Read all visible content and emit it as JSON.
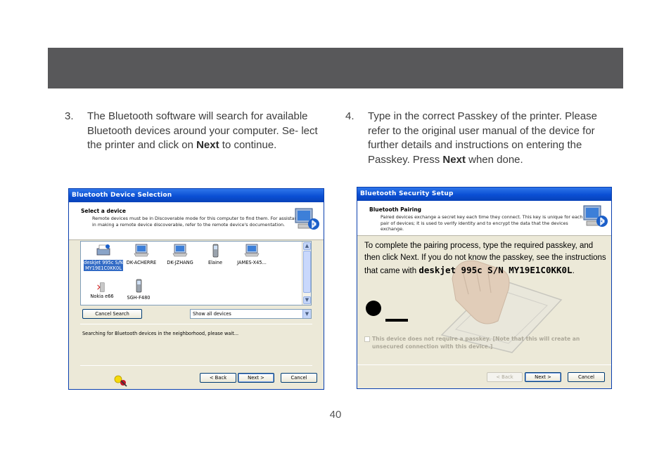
{
  "step3": {
    "number": "3.",
    "text_before": "The Bluetooth software will search for available Bluetooth devices around your computer.  Se- lect the printer and click on ",
    "bold": "Next",
    "text_after": " to continue."
  },
  "step4": {
    "number": "4.",
    "text_before": "Type in the correct Passkey of the printer. Please refer to the original user manual of the device for further details and instructions on entering the Passkey.  Press ",
    "bold": "Next",
    "text_after": " when done."
  },
  "dialog1": {
    "title": "Bluetooth Device Selection",
    "heading": "Select a device",
    "description": "Remote devices must be in Discoverable mode for this computer to find them. For assistance in making a remote device discoverable, refer to the remote device's documentation.",
    "devices": [
      {
        "label": "deskjet 995c S/N MY19E1C0KK0L",
        "icon": "printer-icon"
      },
      {
        "label": "DK-ACHERRE",
        "icon": "laptop-icon"
      },
      {
        "label": "DK-JZHANG",
        "icon": "laptop-icon"
      },
      {
        "label": "Elaine",
        "icon": "phone-icon"
      },
      {
        "label": "JAMES-X45...",
        "icon": "laptop-icon"
      },
      {
        "label": "Nokia e66",
        "icon": "phone-icon"
      },
      {
        "label": "SGH-F480",
        "icon": "phone-icon"
      }
    ],
    "cancel_search": "Cancel Search",
    "filter_selected": "Show all devices",
    "status": "Searching for Bluetooth devices in the neighborhood, please wait...",
    "back": "< Back",
    "next": "Next >",
    "cancel": "Cancel"
  },
  "dialog2": {
    "title": "Bluetooth Security Setup",
    "heading": "Bluetooth Pairing",
    "description": "Paired devices exchange a secret key each time they connect. This key is unique for each pair of devices; it is used to verify identity and to encrypt the data that the devices exchange.",
    "instructions": "To complete the pairing process, type the required passkey, and then click Next. If you do not know the passkey, see the instructions that came with ",
    "device_name": "deskjet 995c S/N MY19E1C0KK0L",
    "instructions_end": ".",
    "no_passkey": "This device does not require a passkey. [Note that this will create an unsecured connection with this device.]",
    "back": "< Back",
    "next": "Next >",
    "cancel": "Cancel"
  },
  "page_number": "40",
  "colors": {
    "header_bar": "#58585a",
    "xp_title": "#0a4fd4",
    "selection": "#316ac5"
  }
}
